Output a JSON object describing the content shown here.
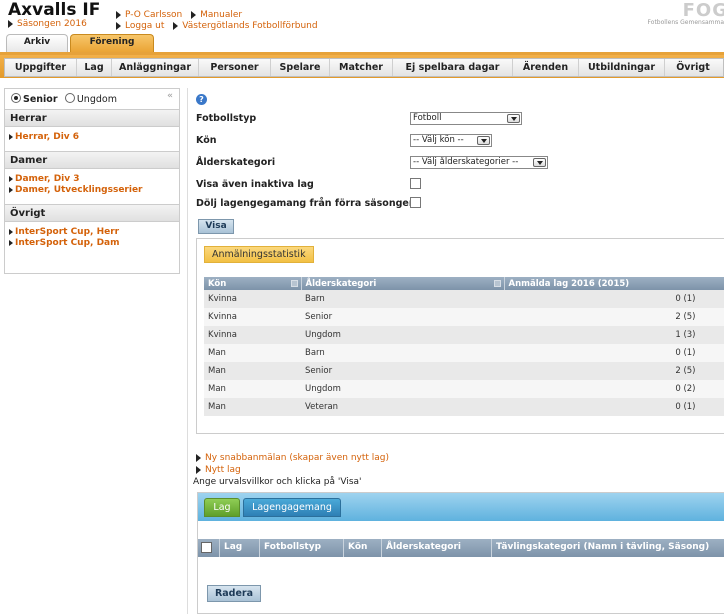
{
  "header": {
    "club_name": "Axvalls IF",
    "season": "Säsongen 2016",
    "links": {
      "user": "P-O Carlsson",
      "manuals": "Manualer",
      "logout": "Logga ut",
      "federation": "Västergötlands Fotbollförbund"
    },
    "brand": "FOG",
    "brand_sub": "Fotbollens Gemensamma"
  },
  "top_tabs": [
    {
      "label": "Arkiv",
      "active": false
    },
    {
      "label": "Förening",
      "active": true
    }
  ],
  "menu": [
    "Uppgifter",
    "Lag",
    "Anläggningar",
    "Personer",
    "Spelare",
    "Matcher",
    "Ej spelbara dagar",
    "Ärenden",
    "Utbildningar",
    "Övrigt"
  ],
  "sidebar": {
    "radios": {
      "senior": "Senior",
      "ungdom": "Ungdom",
      "selected": "Senior"
    },
    "collapse_icon": "«",
    "sections": [
      {
        "title": "Herrar",
        "items": [
          "Herrar, Div 6"
        ]
      },
      {
        "title": "Damer",
        "items": [
          "Damer, Div 3",
          "Damer, Utvecklingsserier"
        ]
      },
      {
        "title": "Övrigt",
        "items": [
          "InterSport Cup, Herr",
          "InterSport Cup, Dam"
        ]
      }
    ]
  },
  "form": {
    "help_icon": "?",
    "labels": {
      "fotbollstyp": "Fotbollstyp",
      "kon": "Kön",
      "alderskategori": "Ålderskategori",
      "inaktiva": "Visa även inaktiva lag",
      "dolj": "Dölj lagengegamang från förra säsongen"
    },
    "values": {
      "fotbollstyp": "Fotboll",
      "kon": "-- Välj kön --",
      "alderskategori": "-- Välj ålderskategorier --"
    },
    "visa_button": "Visa"
  },
  "stats": {
    "tab": "Anmälningsstatistik",
    "columns": [
      "Kön",
      "Ålderskategori",
      "Anmälda lag 2016 (2015)"
    ],
    "rows": [
      [
        "Kvinna",
        "Barn",
        "0 (1)"
      ],
      [
        "Kvinna",
        "Senior",
        "2 (5)"
      ],
      [
        "Kvinna",
        "Ungdom",
        "1 (3)"
      ],
      [
        "Man",
        "Barn",
        "0 (1)"
      ],
      [
        "Man",
        "Senior",
        "2 (5)"
      ],
      [
        "Man",
        "Ungdom",
        "0 (2)"
      ],
      [
        "Man",
        "Veteran",
        "0 (1)"
      ]
    ]
  },
  "actions": {
    "quick_register": "Ny snabbanmälan (skapar även nytt lag)",
    "new_team": "Nytt lag",
    "hint": "Ange urvalsvillkor och klicka på 'Visa'"
  },
  "teams": {
    "tabs": [
      "Lag",
      "Lagengagemang"
    ],
    "columns": [
      "Lag",
      "Fotbollstyp",
      "Kön",
      "Ålderskategori",
      "Tävlingskategori (Namn i tävling, Säsong)"
    ],
    "delete_button": "Radera"
  },
  "colors": {
    "accent": "#d4620a",
    "menubar": "#e9a233",
    "table_header": "#8ba0b6",
    "teams_tabbar": "#6fbce5"
  }
}
